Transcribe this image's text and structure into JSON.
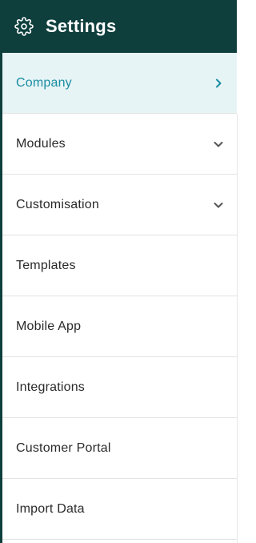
{
  "header": {
    "title": "Settings",
    "icon": "gear-icon"
  },
  "colors": {
    "header_bg": "#0e3f3d",
    "active_bg": "#e6f4f6",
    "active_text": "#1a8ca1",
    "text": "#2a2a2a"
  },
  "menu": {
    "items": [
      {
        "label": "Company",
        "icon": "chevron-right-icon",
        "active": true
      },
      {
        "label": "Modules",
        "icon": "chevron-down-icon"
      },
      {
        "label": "Customisation",
        "icon": "chevron-down-icon"
      },
      {
        "label": "Templates"
      },
      {
        "label": "Mobile App"
      },
      {
        "label": "Integrations"
      },
      {
        "label": "Customer Portal"
      },
      {
        "label": "Import Data"
      }
    ]
  }
}
